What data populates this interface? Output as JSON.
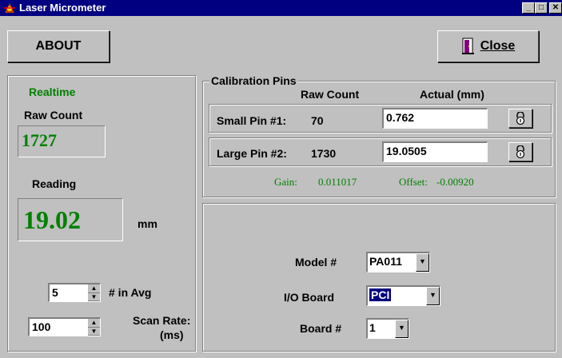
{
  "window": {
    "title": "Laser Micrometer",
    "minimize": "_",
    "maximize": "□",
    "close": "✕"
  },
  "toolbar": {
    "about_label": "ABOUT",
    "close_label": "Close"
  },
  "realtime": {
    "heading": "Realtime",
    "raw_count_label": "Raw Count",
    "raw_count_value": "1727",
    "reading_label": "Reading",
    "reading_value": "19.02",
    "reading_unit": "mm",
    "avg_value": "5",
    "avg_label": "# in Avg",
    "scan_value": "100",
    "scan_label_line1": "Scan Rate:",
    "scan_label_line2": "(ms)"
  },
  "calibration": {
    "title": "Calibration Pins",
    "col_raw": "Raw Count",
    "col_actual": "Actual (mm)",
    "pins": [
      {
        "label": "Small Pin #1:",
        "raw": "70",
        "actual": "0.762"
      },
      {
        "label": "Large Pin #2:",
        "raw": "1730",
        "actual": "19.0505"
      }
    ],
    "gain_label": "Gain:",
    "gain_value": "0.011017",
    "offset_label": "Offset:",
    "offset_value": "-0.00920"
  },
  "settings": {
    "model_label": "Model #",
    "model_value": "PA011",
    "io_label": "I/O Board",
    "io_value": "PCI",
    "board_label": "Board #",
    "board_value": "1"
  },
  "icons": {
    "lock": "lock-icon",
    "door": "door-icon",
    "app": "laser-icon"
  }
}
